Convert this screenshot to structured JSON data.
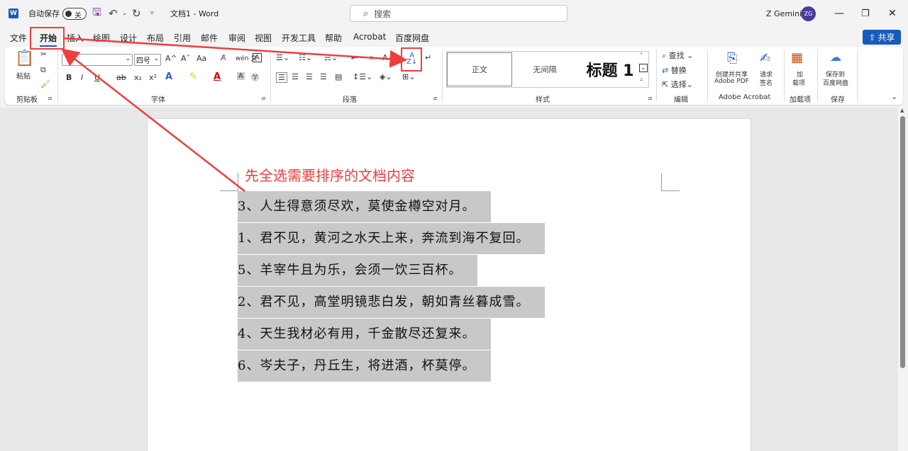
{
  "titlebar": {
    "logo": "W",
    "autosave_label": "自动保存",
    "autosave_state": "关",
    "doc_title": "文档1 - Word",
    "search_placeholder": "搜索",
    "user_name": "Z Gemini",
    "avatar_initials": "ZG"
  },
  "menu": {
    "tabs": [
      "文件",
      "开始",
      "插入",
      "绘图",
      "设计",
      "布局",
      "引用",
      "邮件",
      "审阅",
      "视图",
      "开发工具",
      "帮助",
      "Acrobat",
      "百度网盘"
    ],
    "active_tab": "开始",
    "share_label": "共享"
  },
  "ribbon": {
    "clipboard": {
      "paste": "粘贴",
      "label": "剪贴板"
    },
    "font": {
      "size": "四号",
      "label": "字体",
      "bold": "B",
      "italic": "I",
      "underline": "U",
      "strike": "ab",
      "sub": "x₂",
      "sup": "x²",
      "grow": "A^",
      "shrink": "Aˇ",
      "case": "Aa",
      "wen": "wén 文",
      "border_a": "A"
    },
    "paragraph": {
      "label": "段落",
      "sort_icon": "A↓Z"
    },
    "styles": {
      "label": "样式",
      "normal": "正文",
      "no_spacing": "无间隔",
      "heading1": "标题 1"
    },
    "editing": {
      "label": "编辑",
      "find": "查找",
      "replace": "替换",
      "select": "选择"
    },
    "acrobat": {
      "label": "Adobe Acrobat",
      "create_share": "创建并共享",
      "create_share2": "Adobe PDF",
      "request": "请求",
      "request2": "签名"
    },
    "addins": {
      "label": "加载项",
      "btn1": "加",
      "btn2": "载项"
    },
    "save": {
      "label": "保存",
      "btn1": "保存到",
      "btn2": "百度网盘"
    }
  },
  "document": {
    "annotation": "先全选需要排序的文档内容",
    "lines": [
      "3、人生得意须尽欢，莫使金樽空对月。",
      "1、君不见，黄河之水天上来，奔流到海不复回。",
      "5、羊宰牛且为乐，会须一饮三百杯。",
      "2、君不见，高堂明镜悲白发，朝如青丝暮成雪。",
      "4、天生我材必有用，千金散尽还复来。",
      "6、岑夫子，丹丘生，将进酒，杯莫停。"
    ]
  },
  "colors": {
    "accent": "#185abd",
    "annotation_red": "#ee3e3e",
    "selection": "#c8c8c8"
  }
}
